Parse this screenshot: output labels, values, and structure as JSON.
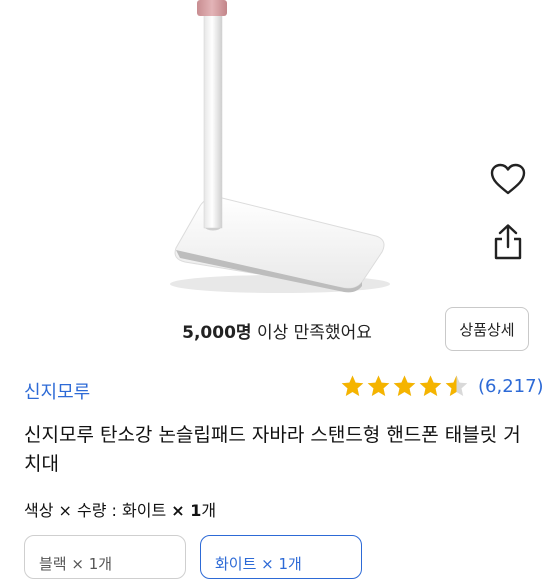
{
  "product": {
    "satisfaction_count": "5,000명",
    "satisfaction_rest": " 이상 만족했어요",
    "detail_button": "상품상세",
    "brand": "신지모루",
    "rating": 4.5,
    "review_count": "(6,217)",
    "title": "신지모루 탄소강 논슬립패드 자바라 스탠드형 핸드폰 태블릿 거치대",
    "option_label": "색상 × 수량 : 화이트 ",
    "option_qty": "× 1",
    "option_unit": "개"
  },
  "option_chips": [
    {
      "label": "블랙 × 1개"
    },
    {
      "label": "화이트 × 1개"
    }
  ],
  "icons": {
    "wishlist": "heart-outline-icon",
    "share": "share-icon",
    "star": "star-icon"
  },
  "colors": {
    "accent_blue": "#2d6ad6",
    "star_gold": "#f5b400",
    "star_empty": "#d9d9d9",
    "stand_pink": "#d9a3a6"
  }
}
